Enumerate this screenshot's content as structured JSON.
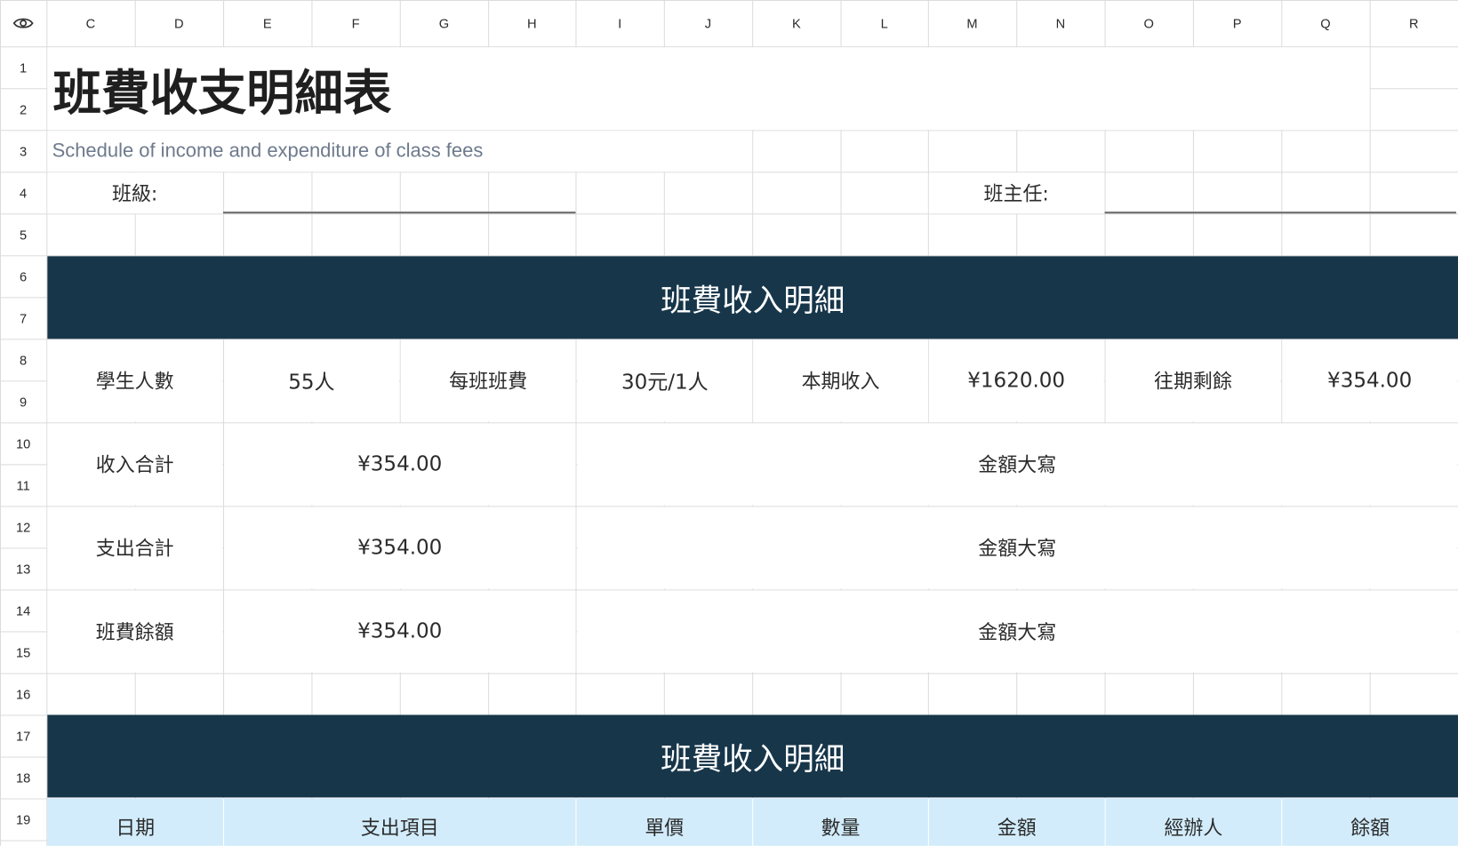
{
  "columns": [
    "C",
    "D",
    "E",
    "F",
    "G",
    "H",
    "I",
    "J",
    "K",
    "L",
    "M",
    "N",
    "O",
    "P",
    "Q",
    "R"
  ],
  "rows": [
    "1",
    "2",
    "3",
    "4",
    "5",
    "6",
    "7",
    "8",
    "9",
    "10",
    "11",
    "12",
    "13",
    "14",
    "15",
    "16",
    "17",
    "18",
    "19"
  ],
  "sheet": {
    "title": "班費收支明細表",
    "subtitle": "Schedule of income and expenditure of class fees",
    "class_label": "班級:",
    "teacher_label": "班主任:",
    "income_section_title": "班費收入明細",
    "info_row": {
      "students_label": "學生人數",
      "students_value": "55人",
      "fee_label": "每班班費",
      "fee_value": "30元/1人",
      "period_income_label": "本期收入",
      "period_income_value": "¥1620.00",
      "prior_balance_label": "往期剩餘",
      "prior_balance_value": "¥354.00"
    },
    "summary": [
      {
        "label": "收入合計",
        "value": "¥354.00",
        "caps_label": "金額大寫"
      },
      {
        "label": "支出合計",
        "value": "¥354.00",
        "caps_label": "金額大寫"
      },
      {
        "label": "班費餘額",
        "value": "¥354.00",
        "caps_label": "金額大寫"
      }
    ],
    "expense_section_title": "班費收入明細",
    "expense_headers": [
      "日期",
      "支出項目",
      "單價",
      "數量",
      "金額",
      "經辦人",
      "餘額"
    ]
  },
  "icons": {
    "corner": "eye-icon"
  },
  "colors": {
    "banner": "#17364a",
    "header_band": "#d2ecfb",
    "subtitle": "#6e7a8c"
  }
}
